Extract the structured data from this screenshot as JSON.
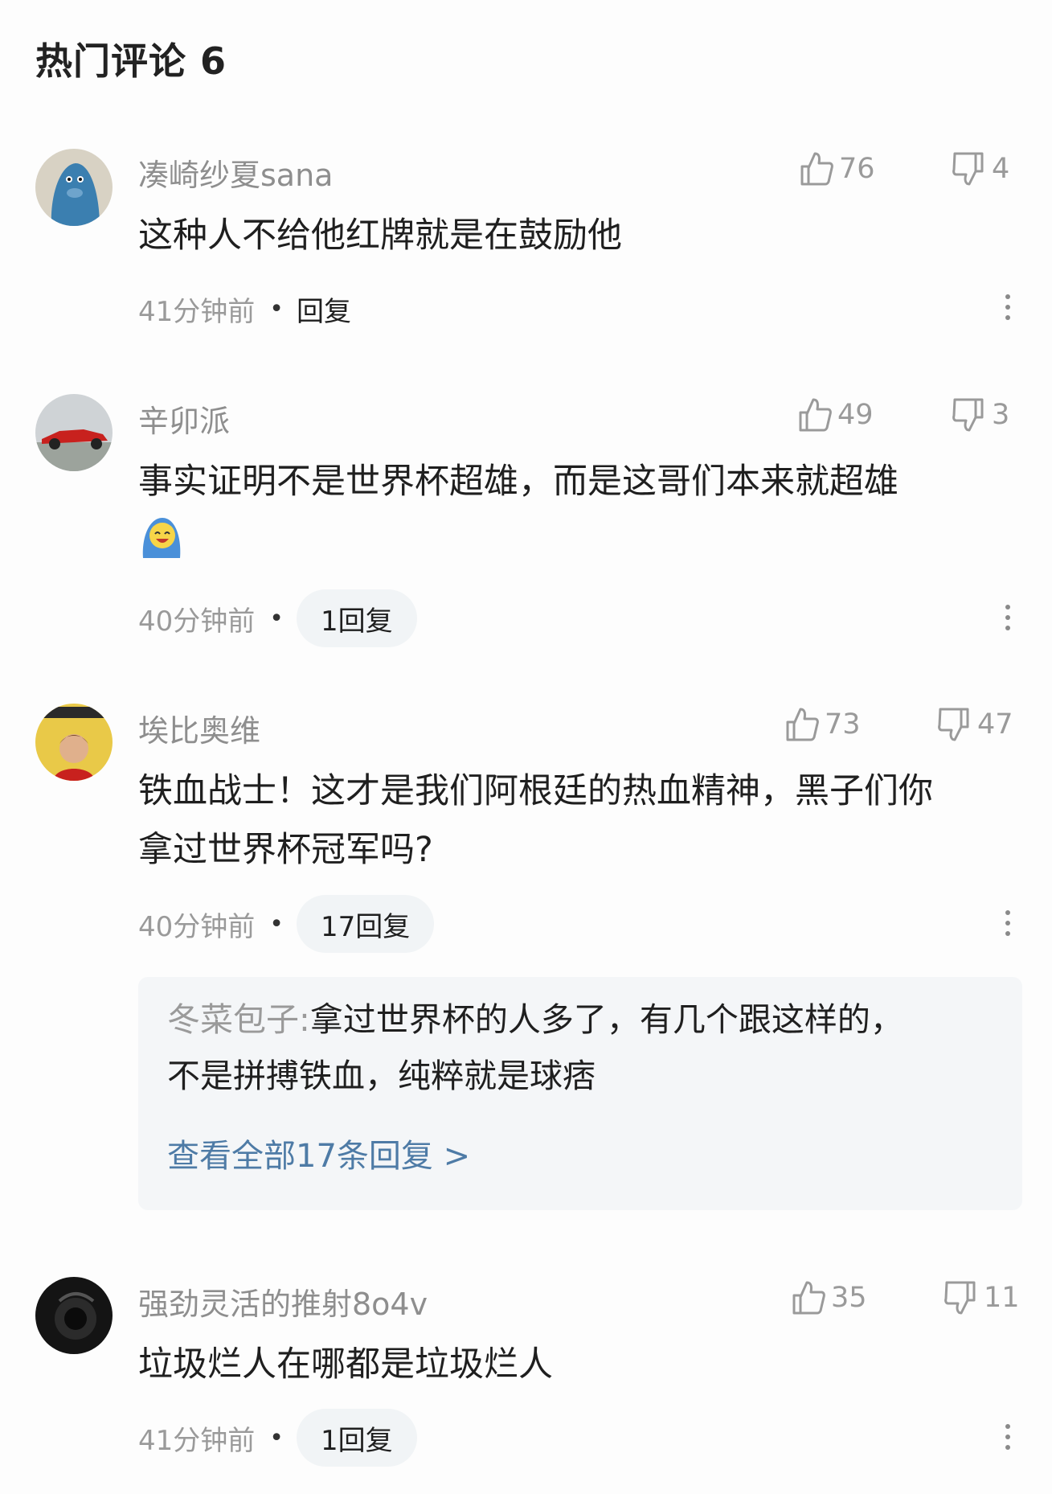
{
  "section_title": "热门评论 6",
  "colors": {
    "link": "#4e7ba6",
    "muted": "#9a9a9a",
    "pill_bg": "#f1f4f6"
  },
  "comments": [
    {
      "avatar_icon": "blue-creature-avatar",
      "username": "凑崎纱夏sana",
      "likes": "76",
      "dislikes": "4",
      "text": "这种人不给他红牌就是在鼓励他",
      "time": "41分钟前",
      "reply_label": "回复"
    },
    {
      "avatar_icon": "race-car-avatar",
      "username": "辛卯派",
      "likes": "49",
      "dislikes": "3",
      "text": "事实证明不是世界杯超雄，而是这哥们本来就超雄",
      "emoji": "laughing-emoji",
      "time": "40分钟前",
      "reply_label": "1回复"
    },
    {
      "avatar_icon": "player-portrait-avatar",
      "username": "埃比奥维",
      "likes": "73",
      "dislikes": "47",
      "text_line1": "铁血战士！这才是我们阿根廷的热血精神，黑子们你",
      "text_line2": "拿过世界杯冠军吗?",
      "time": "40分钟前",
      "reply_label": "17回复",
      "reply_preview": {
        "author": "冬菜包子:",
        "text_line1": "拿过世界杯的人多了，有几个跟这样的，",
        "text_line2": "不是拼搏铁血，纯粹就是球痞",
        "view_all": "查看全部17条回复 >"
      }
    },
    {
      "avatar_icon": "headphones-avatar",
      "username": "强劲灵活的推射8o4v",
      "likes": "35",
      "dislikes": "11",
      "text": "垃圾烂人在哪都是垃圾烂人",
      "time": "41分钟前",
      "reply_label": "1回复"
    }
  ]
}
